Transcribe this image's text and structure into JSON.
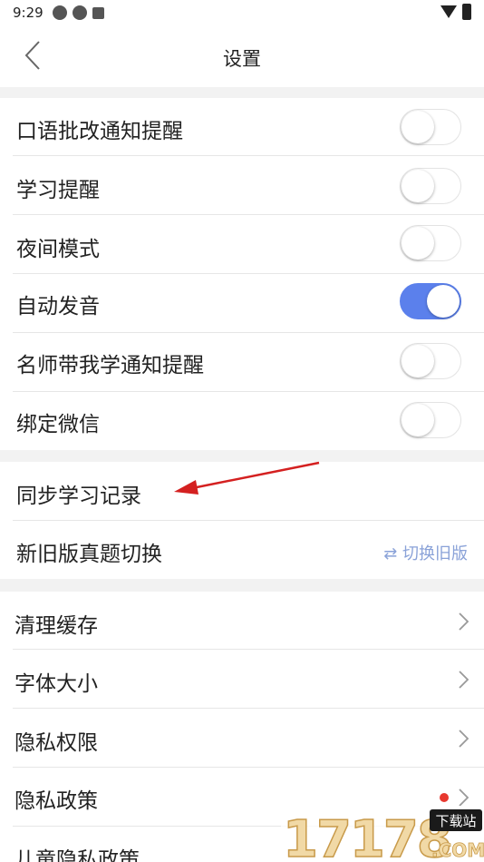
{
  "status_bar": {
    "time": "9:29"
  },
  "header": {
    "title": "设置"
  },
  "toggles": [
    {
      "label": "口语批改通知提醒",
      "on": false
    },
    {
      "label": "学习提醒",
      "on": false
    },
    {
      "label": "夜间模式",
      "on": false
    },
    {
      "label": "自动发音",
      "on": true
    },
    {
      "label": "名师带我学通知提醒",
      "on": false
    },
    {
      "label": "绑定微信",
      "on": false
    }
  ],
  "sync": {
    "label": "同步学习记录",
    "switch_label": "新旧版真题切换",
    "switch_action": "⇄ 切换旧版"
  },
  "links": [
    {
      "label": "清理缓存"
    },
    {
      "label": "字体大小"
    },
    {
      "label": "隐私权限"
    },
    {
      "label": "隐私政策",
      "badge": true
    },
    {
      "label": "儿童隐私政策"
    }
  ],
  "watermark": {
    "text": "17178",
    "badge": "下载站",
    "sub": ".COM"
  },
  "colors": {
    "accent": "#5b80ec",
    "badge": "#e8382f",
    "arrow": "#d42020"
  }
}
